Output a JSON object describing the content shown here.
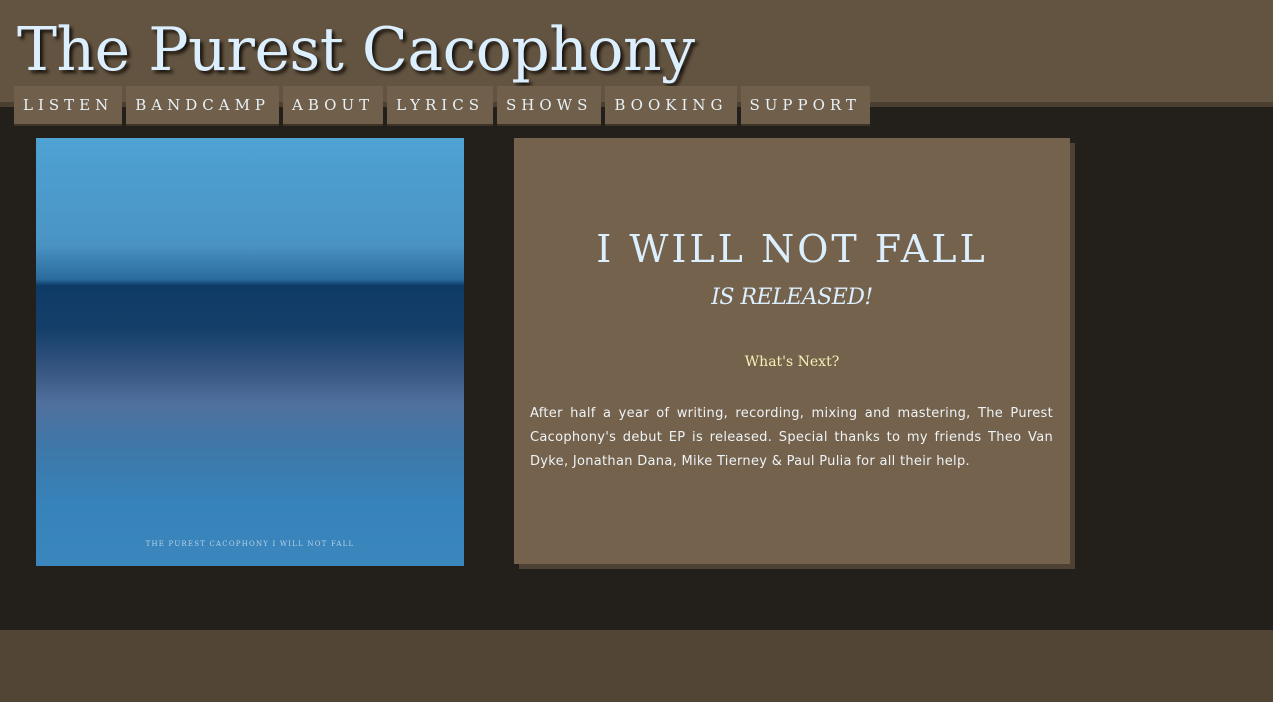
{
  "site": {
    "title": "The Purest Cacophony"
  },
  "nav": {
    "items": [
      {
        "label": "LISTEN"
      },
      {
        "label": "BANDCAMP"
      },
      {
        "label": "ABOUT"
      },
      {
        "label": "LYRICS"
      },
      {
        "label": "SHOWS"
      },
      {
        "label": "BOOKING"
      },
      {
        "label": "SUPPORT"
      }
    ]
  },
  "album": {
    "caption": "THE PUREST CACOPHONY  I WILL NOT FALL"
  },
  "news": {
    "title": "I WILL NOT FALL",
    "subtitle": "IS RELEASED!",
    "next_heading": "What's Next?",
    "body": "After half a year of writing, recording, mixing and mastering, The Purest Cacophony's debut EP is released. Special thanks to my friends Theo Van Dyke, Jonathan Dana, Mike Tierney & Paul Pulia for all their help."
  },
  "colors": {
    "header_bg": "#635441",
    "nav_bg": "#705f4a",
    "main_bg": "#231f1a",
    "card_bg": "#74624c",
    "footer_bg": "#524535",
    "title_text": "#dcefff",
    "accent_yellow": "#f5f0b8"
  }
}
